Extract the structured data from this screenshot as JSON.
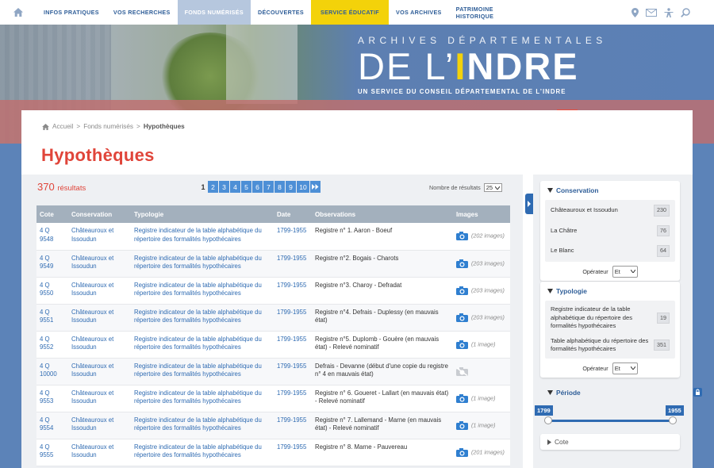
{
  "nav": {
    "items": [
      {
        "label": "INFOS PRATIQUES",
        "state": "normal"
      },
      {
        "label": "VOS RECHERCHES",
        "state": "normal"
      },
      {
        "label": "FONDS NUMÉRISÉS",
        "state": "active"
      },
      {
        "label": "DÉCOUVERTES",
        "state": "normal"
      },
      {
        "label": "SERVICE ÉDUCATIF",
        "state": "edu"
      },
      {
        "label": "VOS ARCHIVES",
        "state": "normal"
      },
      {
        "label": "PATRIMOINE HISTORIQUE",
        "state": "normal"
      }
    ],
    "tool_icons": [
      "location-pin-icon",
      "envelope-icon",
      "accessibility-icon",
      "search-icon"
    ]
  },
  "brand": {
    "top": "ARCHIVES DÉPARTEMENTALES",
    "big_light": "DE L’",
    "big_i": "I",
    "big_rest": "NDRE",
    "sub": "UN SERVICE DU CONSEIL DÉPARTEMENTAL DE L’INDRE",
    "colors": {
      "accent_yellow": "#f3d20a",
      "accent_red": "#e84d3d"
    }
  },
  "breadcrumb": {
    "home": "Accueil",
    "sep": ">",
    "level1": "Fonds numérisés",
    "current": "Hypothèques"
  },
  "page_title": "Hypothèques",
  "results": {
    "count": "370",
    "count_label": "résultats",
    "current_page": "1",
    "pages": [
      "2",
      "3",
      "4",
      "5",
      "6",
      "7",
      "8",
      "9",
      "10"
    ],
    "per_page_label": "Nombre de résultats",
    "per_page": "25"
  },
  "table": {
    "headers": [
      "Cote",
      "Conservation",
      "Typologie",
      "Date",
      "Observations",
      "Images"
    ],
    "rows": [
      {
        "cote": "4 Q 9548",
        "conservation": "Châteauroux et Issoudun",
        "typologie": "Registre indicateur de la table alphabétique du répertoire des formalités hypothécaires",
        "date": "1799-1955",
        "obs": "Registre n° 1. Aaron - Boeuf",
        "images": "(202 images)",
        "available": true
      },
      {
        "cote": "4 Q 9549",
        "conservation": "Châteauroux et Issoudun",
        "typologie": "Registre indicateur de la table alphabétique du répertoire des formalités hypothécaires",
        "date": "1799-1955",
        "obs": "Registre n°2. Bogais - Charots",
        "images": "(203 images)",
        "available": true
      },
      {
        "cote": "4 Q 9550",
        "conservation": "Châteauroux et Issoudun",
        "typologie": "Registre indicateur de la table alphabétique du répertoire des formalités hypothécaires",
        "date": "1799-1955",
        "obs": "Registre n°3. Charoy - Defradat",
        "images": "(203 images)",
        "available": true
      },
      {
        "cote": "4 Q 9551",
        "conservation": "Châteauroux et Issoudun",
        "typologie": "Registre indicateur de la table alphabétique du répertoire des formalités hypothécaires",
        "date": "1799-1955",
        "obs": "Registre n°4. Defrais - Duplessy (en mauvais état)",
        "images": "(203 images)",
        "available": true
      },
      {
        "cote": "4 Q 9552",
        "conservation": "Châteauroux et Issoudun",
        "typologie": "Registre indicateur de la table alphabétique du répertoire des formalités hypothécaires",
        "date": "1799-1955",
        "obs": "Registre n°5. Duplomb - Gouère (en mauvais état) - Relevé nominatif",
        "images": "(1 image)",
        "available": true
      },
      {
        "cote": "4 Q 10000",
        "conservation": "Châteauroux et Issoudun",
        "typologie": "Registre indicateur de la table alphabétique du répertoire des formalités hypothécaires",
        "date": "1799-1955",
        "obs": "Defrais - Devanne (début d'une copie du registre n° 4 en mauvais état)",
        "images": "",
        "available": false
      },
      {
        "cote": "4 Q 9553",
        "conservation": "Châteauroux et Issoudun",
        "typologie": "Registre indicateur de la table alphabétique du répertoire des formalités hypothécaires",
        "date": "1799-1955",
        "obs": "Registre n° 6. Goueret - Lallart (en mauvais état) - Relevé nominatif",
        "images": "(1 image)",
        "available": true
      },
      {
        "cote": "4 Q 9554",
        "conservation": "Châteauroux et Issoudun",
        "typologie": "Registre indicateur de la table alphabétique du répertoire des formalités hypothécaires",
        "date": "1799-1955",
        "obs": "Registre n° 7. Lallemand - Marne (en mauvais état) - Relevé nominatif",
        "images": "(1 image)",
        "available": true
      },
      {
        "cote": "4 Q 9555",
        "conservation": "Châteauroux et Issoudun",
        "typologie": "Registre indicateur de la table alphabétique du répertoire des formalités hypothécaires",
        "date": "1799-1955",
        "obs": "Registre n° 8. Marne - Pauvereau",
        "images": "(201 images)",
        "available": true
      }
    ]
  },
  "facets": {
    "conservation": {
      "title": "Conservation",
      "items": [
        {
          "label": "Châteauroux et Issoudun",
          "count": "230"
        },
        {
          "label": "La Châtre",
          "count": "76"
        },
        {
          "label": "Le Blanc",
          "count": "64"
        }
      ],
      "operator_label": "Opérateur",
      "operator": "Et"
    },
    "typologie": {
      "title": "Typologie",
      "items": [
        {
          "label": "Registre indicateur de la table alphabétique du répertoire des formalités hypothécaires",
          "count": "19"
        },
        {
          "label": "Table alphabétique du répertoire des formalités hypothécaires",
          "count": "351"
        }
      ],
      "operator_label": "Opérateur",
      "operator": "Et"
    },
    "periode": {
      "title": "Période",
      "min": "1799",
      "max": "1955"
    },
    "cote": {
      "title": "Cote"
    }
  }
}
